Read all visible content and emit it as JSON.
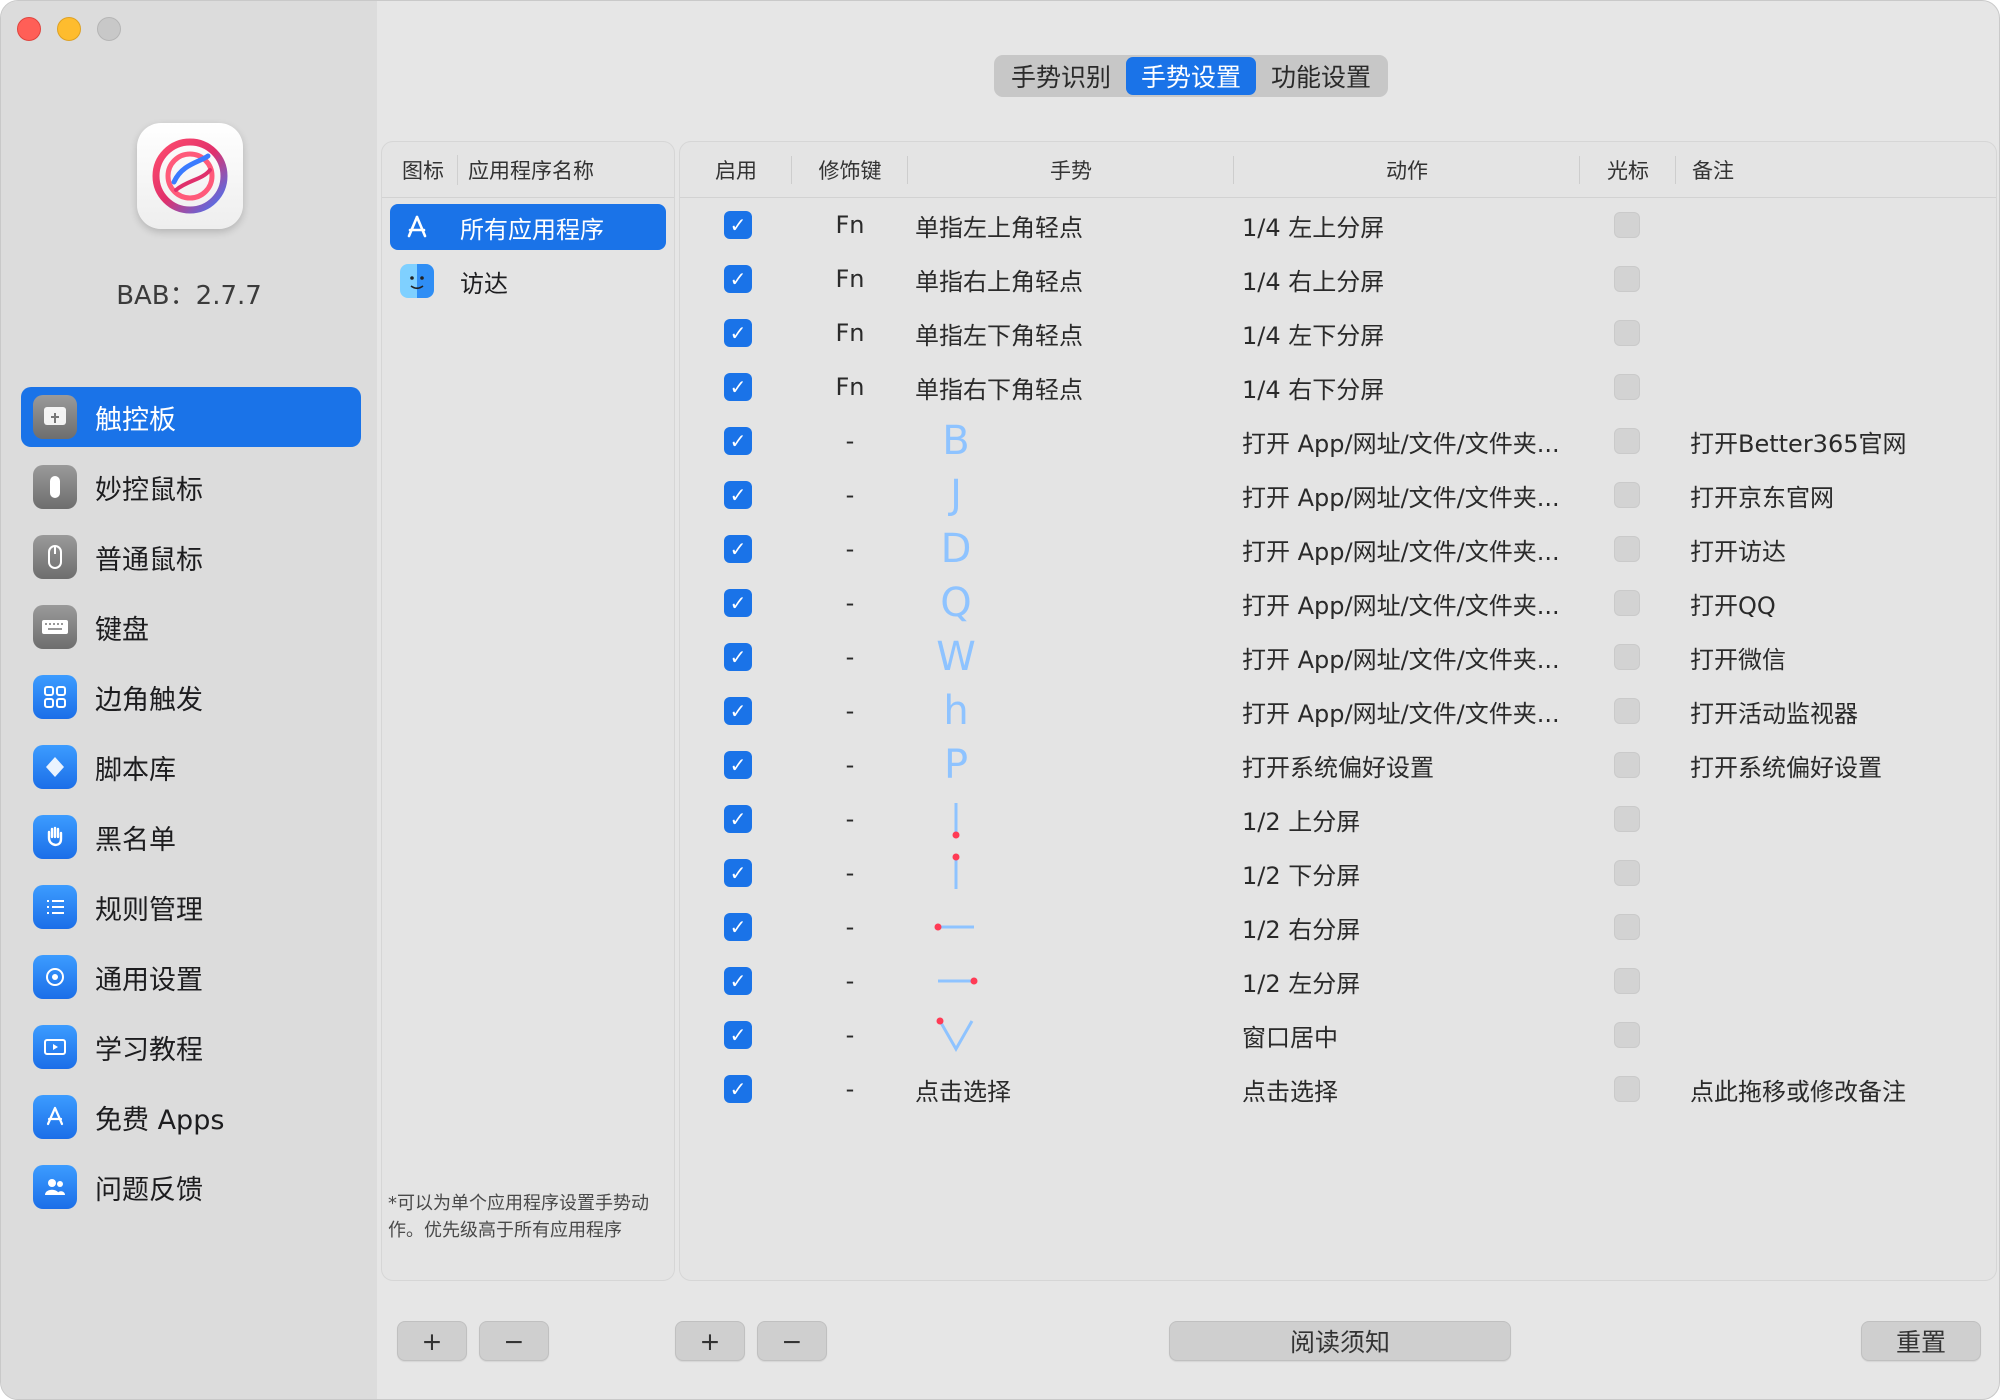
{
  "sidebar": {
    "version": "BAB：2.7.7",
    "items": [
      {
        "label": "触控板",
        "icon": "trackpad-icon",
        "active": true
      },
      {
        "label": "妙控鼠标",
        "icon": "magic-mouse-icon"
      },
      {
        "label": "普通鼠标",
        "icon": "mouse-icon"
      },
      {
        "label": "键盘",
        "icon": "keyboard-icon"
      },
      {
        "label": "边角触发",
        "icon": "corner-grid-icon"
      },
      {
        "label": "脚本库",
        "icon": "script-icon"
      },
      {
        "label": "黑名单",
        "icon": "hand-stop-icon"
      },
      {
        "label": "规则管理",
        "icon": "list-icon"
      },
      {
        "label": "通用设置",
        "icon": "settings-gear-icon"
      },
      {
        "label": "学习教程",
        "icon": "video-tutorial-icon"
      },
      {
        "label": "免费 Apps",
        "icon": "app-store-icon"
      },
      {
        "label": "问题反馈",
        "icon": "users-feedback-icon"
      }
    ]
  },
  "tabs": [
    {
      "label": "手势识别"
    },
    {
      "label": "手势设置",
      "active": true
    },
    {
      "label": "功能设置"
    }
  ],
  "apps": {
    "headers": {
      "icon": "图标",
      "name": "应用程序名称"
    },
    "items": [
      {
        "label": "所有应用程序",
        "icon": "app-store-icon",
        "active": true
      },
      {
        "label": "访达",
        "icon": "finder-icon"
      }
    ],
    "note": "*可以为单个应用程序设置手势动作。优先级高于所有应用程序"
  },
  "table": {
    "headers": {
      "enable": "启用",
      "modifier": "修饰键",
      "gesture": "手势",
      "action": "动作",
      "cursor": "光标",
      "note": "备注"
    },
    "rows": [
      {
        "enabled": true,
        "modifier": "Fn",
        "gesture_text": "单指左上角轻点",
        "action": "1/4 左上分屏",
        "note": ""
      },
      {
        "enabled": true,
        "modifier": "Fn",
        "gesture_text": "单指右上角轻点",
        "action": "1/4 右上分屏",
        "note": ""
      },
      {
        "enabled": true,
        "modifier": "Fn",
        "gesture_text": "单指左下角轻点",
        "action": "1/4 左下分屏",
        "note": ""
      },
      {
        "enabled": true,
        "modifier": "Fn",
        "gesture_text": "单指右下角轻点",
        "action": "1/4 右下分屏",
        "note": ""
      },
      {
        "enabled": true,
        "modifier": "-",
        "gesture_glyph": "B",
        "action": "打开 App/网址/文件/文件夹...",
        "note": "打开Better365官网"
      },
      {
        "enabled": true,
        "modifier": "-",
        "gesture_glyph": "J",
        "action": "打开 App/网址/文件/文件夹...",
        "note": "打开京东官网"
      },
      {
        "enabled": true,
        "modifier": "-",
        "gesture_glyph": "D",
        "action": "打开 App/网址/文件/文件夹...",
        "note": "打开访达"
      },
      {
        "enabled": true,
        "modifier": "-",
        "gesture_glyph": "Q",
        "action": "打开 App/网址/文件/文件夹...",
        "note": "打开QQ"
      },
      {
        "enabled": true,
        "modifier": "-",
        "gesture_glyph": "W",
        "action": "打开 App/网址/文件/文件夹...",
        "note": "打开微信"
      },
      {
        "enabled": true,
        "modifier": "-",
        "gesture_glyph": "h",
        "action": "打开 App/网址/文件/文件夹...",
        "note": "打开活动监视器"
      },
      {
        "enabled": true,
        "modifier": "-",
        "gesture_glyph": "P",
        "action": "打开系统偏好设置",
        "note": "打开系统偏好设置"
      },
      {
        "enabled": true,
        "modifier": "-",
        "gesture_glyph": "swipe-up",
        "action": "1/2 上分屏",
        "note": ""
      },
      {
        "enabled": true,
        "modifier": "-",
        "gesture_glyph": "swipe-down",
        "action": "1/2 下分屏",
        "note": ""
      },
      {
        "enabled": true,
        "modifier": "-",
        "gesture_glyph": "swipe-right",
        "action": "1/2 右分屏",
        "note": ""
      },
      {
        "enabled": true,
        "modifier": "-",
        "gesture_glyph": "swipe-left",
        "action": "1/2 左分屏",
        "note": ""
      },
      {
        "enabled": true,
        "modifier": "-",
        "gesture_glyph": "V",
        "action": "窗口居中",
        "note": ""
      },
      {
        "enabled": true,
        "modifier": "-",
        "gesture_text": "点击选择",
        "action": "点击选择",
        "note": "点此拖移或修改备注"
      }
    ]
  },
  "bottom": {
    "app_add": "+",
    "app_remove": "−",
    "row_add": "+",
    "row_remove": "−",
    "read_notice": "阅读须知",
    "reset": "重置"
  },
  "colors": {
    "accent": "#1a73e8",
    "gesture_stroke": "#8ec3ff",
    "gesture_dot": "#ff3b55"
  }
}
